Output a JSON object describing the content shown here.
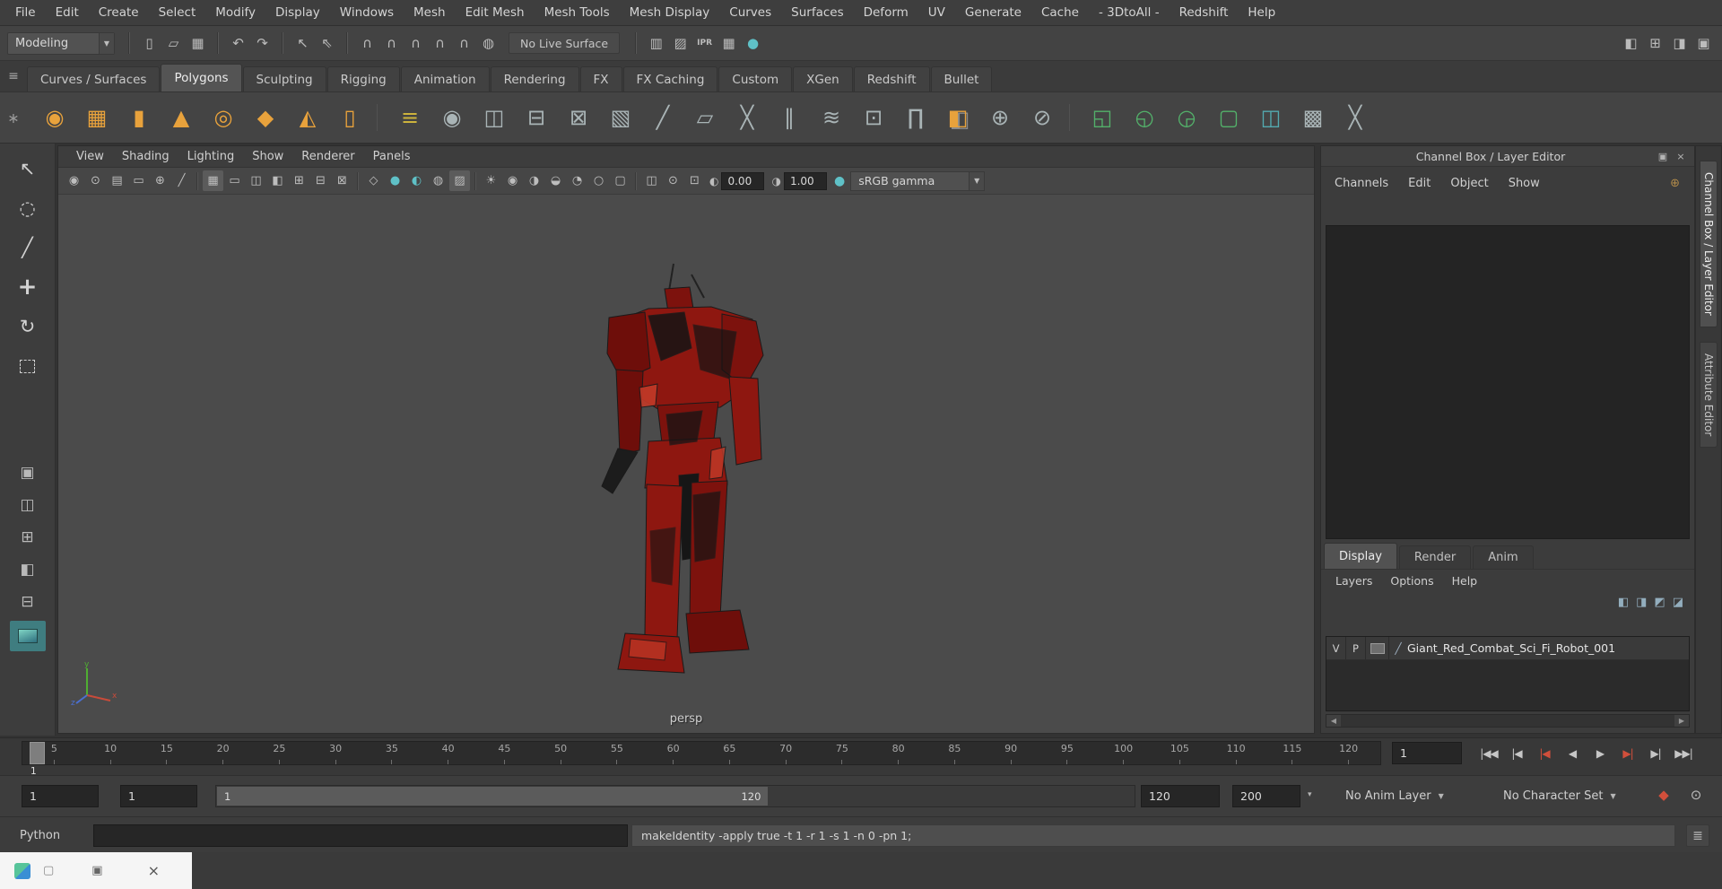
{
  "colors": {
    "shelf_orange": "#e8a23c",
    "shelf_green": "#53b06a",
    "viewport_teal": "#5fc1c7",
    "autokey_red": "#d14f3b",
    "robot_red": "#8e1710",
    "selection_blue": "#5285a6"
  },
  "menu_bar": {
    "items": [
      "File",
      "Edit",
      "Create",
      "Select",
      "Modify",
      "Display",
      "Windows",
      "Mesh",
      "Edit Mesh",
      "Mesh Tools",
      "Mesh Display",
      "Curves",
      "Surfaces",
      "Deform",
      "UV",
      "Generate",
      "Cache",
      "- 3DtoAll -",
      "Redshift",
      "Help"
    ]
  },
  "icons": {
    "chevron_down": "▼",
    "chevron_small": "▾",
    "shelf_menu": "≡",
    "shelf_gear": "∗",
    "scroll_left": "◀",
    "scroll_right": "▶",
    "script_editor": "≣",
    "exposure": "◐",
    "gamma": "◑",
    "color_management": "●",
    "layer_type": "╱",
    "manipulator": "⊕"
  },
  "toolbar": {
    "mode_selector": "Modeling",
    "live_surface": "No Live Surface",
    "file_icons": [
      {
        "name": "new-scene-icon",
        "glyph": "▯"
      },
      {
        "name": "open-scene-icon",
        "glyph": "▱"
      },
      {
        "name": "save-scene-icon",
        "glyph": "▦"
      }
    ],
    "undo_icons": [
      {
        "name": "undo-icon",
        "glyph": "↶"
      },
      {
        "name": "redo-icon",
        "glyph": "↷"
      }
    ],
    "selection_icons": [
      {
        "name": "select-by-hierarchy-icon",
        "glyph": "↖"
      },
      {
        "name": "select-by-object-icon",
        "glyph": "⇖"
      }
    ],
    "snap_icons": [
      {
        "name": "snap-to-grid-icon",
        "glyph": "∩"
      },
      {
        "name": "snap-to-curve-icon",
        "glyph": "∩"
      },
      {
        "name": "snap-to-point-icon",
        "glyph": "∩"
      },
      {
        "name": "snap-to-projected-center-icon",
        "glyph": "∩"
      },
      {
        "name": "snap-to-view-plane-icon",
        "glyph": "∩"
      },
      {
        "name": "make-live-icon",
        "glyph": "◍"
      }
    ],
    "render_icons": [
      {
        "name": "render-view-icon",
        "glyph": "▥"
      },
      {
        "name": "render-current-frame-icon",
        "glyph": "▨"
      },
      {
        "name": "ipr-render-icon",
        "glyph": "IPR",
        "cls": "ipr"
      },
      {
        "name": "render-settings-icon",
        "glyph": "▦"
      },
      {
        "name": "hypershade-icon",
        "glyph": "●",
        "cls": "teal"
      }
    ],
    "workspace_icons": [
      {
        "name": "workspace-outliner-icon",
        "glyph": "◧"
      },
      {
        "name": "workspace-four-view-icon",
        "glyph": "⊞"
      },
      {
        "name": "workspace-side-by-side-icon",
        "glyph": "◨"
      },
      {
        "name": "workspace-full-icon",
        "glyph": "▣"
      }
    ]
  },
  "shelf": {
    "tabs": [
      {
        "label": "Curves / Surfaces"
      },
      {
        "label": "Polygons",
        "active": true
      },
      {
        "label": "Sculpting"
      },
      {
        "label": "Rigging"
      },
      {
        "label": "Animation"
      },
      {
        "label": "Rendering"
      },
      {
        "label": "FX"
      },
      {
        "label": "FX Caching"
      },
      {
        "label": "Custom"
      },
      {
        "label": "XGen"
      },
      {
        "label": "Redshift"
      },
      {
        "label": "Bullet"
      }
    ],
    "primitive_icons": [
      {
        "name": "poly-sphere-icon",
        "glyph": "◉",
        "cls": "orange"
      },
      {
        "name": "poly-cube-icon",
        "glyph": "▦",
        "cls": "orange"
      },
      {
        "name": "poly-cylinder-icon",
        "glyph": "▮",
        "cls": "orange"
      },
      {
        "name": "poly-cone-icon",
        "glyph": "▲",
        "cls": "orange"
      },
      {
        "name": "poly-torus-icon",
        "glyph": "◎",
        "cls": "orange"
      },
      {
        "name": "poly-plane-icon",
        "glyph": "◆",
        "cls": "orange"
      },
      {
        "name": "poly-pyramid-icon",
        "glyph": "◭",
        "cls": "orange"
      },
      {
        "name": "poly-pipe-icon",
        "glyph": "▯",
        "cls": "orange"
      }
    ],
    "edit_icons": [
      {
        "name": "sweep-mesh-icon",
        "glyph": "≡",
        "cls": "olive"
      },
      {
        "name": "smooth-mesh-icon",
        "glyph": "◉"
      },
      {
        "name": "combine-icon",
        "glyph": "◫"
      },
      {
        "name": "separate-icon",
        "glyph": "⊟"
      },
      {
        "name": "extract-icon",
        "glyph": "⊠"
      },
      {
        "name": "fill-hole-icon",
        "glyph": "▧"
      },
      {
        "name": "create-polygon-icon",
        "glyph": "╱"
      },
      {
        "name": "quad-draw-icon",
        "glyph": "▱"
      },
      {
        "name": "multi-cut-icon",
        "glyph": "╳"
      },
      {
        "name": "insert-edge-loop-icon",
        "glyph": "∥"
      },
      {
        "name": "offset-edge-loop-icon",
        "glyph": "≋"
      },
      {
        "name": "target-weld-icon",
        "glyph": "⊡"
      },
      {
        "name": "bridge-icon",
        "glyph": "∏"
      },
      {
        "name": "mirror-icon",
        "glyph": "◧",
        "cls": "mix"
      },
      {
        "name": "center-pivot-icon",
        "glyph": "⊕"
      },
      {
        "name": "freeze-transformations-icon",
        "glyph": "⊘"
      }
    ],
    "boolean_icons": [
      {
        "name": "boolean-union-icon",
        "glyph": "◱",
        "cls": "green"
      },
      {
        "name": "boolean-difference-icon",
        "glyph": "◵",
        "cls": "green"
      },
      {
        "name": "boolean-intersection-icon",
        "glyph": "◶",
        "cls": "green"
      },
      {
        "name": "boolean-slice-icon",
        "glyph": "▢",
        "cls": "green"
      },
      {
        "name": "duplicate-along-path-icon",
        "glyph": "◫",
        "cls": "teal"
      },
      {
        "name": "uv-checker-icon",
        "glyph": "▩"
      },
      {
        "name": "transfer-attributes-icon",
        "glyph": "╳"
      }
    ]
  },
  "toolbox": {
    "tools": [
      {
        "name": "select-tool",
        "glyph": "↖"
      },
      {
        "name": "lasso-tool",
        "glyph": "◌"
      },
      {
        "name": "paint-select-tool",
        "glyph": "╱"
      },
      {
        "name": "move-tool",
        "glyph": "+",
        "cls": "big"
      },
      {
        "name": "rotate-tool",
        "glyph": "↻"
      },
      {
        "name": "scale-tool",
        "glyph": "",
        "cls": "dashed"
      }
    ],
    "layouts": [
      {
        "name": "single-pane-layout-icon",
        "glyph": "▣"
      },
      {
        "name": "two-pane-layout-icon",
        "glyph": "◫"
      },
      {
        "name": "four-pane-layout-icon",
        "glyph": "⊞"
      },
      {
        "name": "outliner-layout-icon",
        "glyph": "◧"
      },
      {
        "name": "graph-editor-layout-icon",
        "glyph": "⊟"
      },
      {
        "name": "persp-camera-thumbnail-icon",
        "glyph": "▰",
        "cls": "teal-bg"
      }
    ]
  },
  "viewport": {
    "menus": [
      "View",
      "Shading",
      "Lighting",
      "Show",
      "Renderer",
      "Panels"
    ],
    "camera_icons": [
      {
        "name": "camera-icon",
        "glyph": "◉"
      },
      {
        "name": "camera-attributes-icon",
        "glyph": "⊙"
      },
      {
        "name": "bookmark-icon",
        "glyph": "▤"
      },
      {
        "name": "image-plane-icon",
        "glyph": "▭"
      },
      {
        "name": "two-d-pan-zoom-icon",
        "glyph": "⊕"
      },
      {
        "name": "grease-pencil-icon",
        "glyph": "╱"
      }
    ],
    "gate_icons": [
      {
        "name": "grid-toggle-icon",
        "glyph": "▦",
        "cls": "active"
      },
      {
        "name": "film-gate-icon",
        "glyph": "▭"
      },
      {
        "name": "resolution-gate-icon",
        "glyph": "◫"
      },
      {
        "name": "gate-mask-icon",
        "glyph": "◧"
      },
      {
        "name": "field-chart-icon",
        "glyph": "⊞"
      },
      {
        "name": "safe-action-icon",
        "glyph": "⊟"
      },
      {
        "name": "safe-title-icon",
        "glyph": "⊠"
      }
    ],
    "shade_icons": [
      {
        "name": "wireframe-icon",
        "glyph": "◇"
      },
      {
        "name": "smooth-shade-icon",
        "glyph": "●",
        "cls": "teal"
      },
      {
        "name": "textured-icon",
        "glyph": "◐",
        "cls": "teal"
      },
      {
        "name": "wireframe-on-shaded-icon",
        "glyph": "◍"
      },
      {
        "name": "use-default-material-icon",
        "glyph": "▨",
        "cls": "active"
      }
    ],
    "light_icons": [
      {
        "name": "default-lighting-icon",
        "glyph": "☀"
      },
      {
        "name": "all-lights-icon",
        "glyph": "◉"
      },
      {
        "name": "shadows-icon",
        "glyph": "◑"
      },
      {
        "name": "occlusion-icon",
        "glyph": "◒"
      },
      {
        "name": "motion-blur-icon",
        "glyph": "◔"
      },
      {
        "name": "multisample-icon",
        "glyph": "○"
      },
      {
        "name": "isolate-select-icon",
        "glyph": "▢"
      }
    ],
    "xray_icons": [
      {
        "name": "xray-icon",
        "glyph": "◫"
      },
      {
        "name": "xray-joints-icon",
        "glyph": "⊙"
      },
      {
        "name": "exposure-contrast-icon",
        "glyph": "⊡"
      }
    ],
    "exposure": "0.00",
    "gamma": "1.00",
    "view_transform": "sRGB gamma",
    "camera_label": "persp",
    "axis": {
      "x": "x",
      "y": "y",
      "z": "z"
    }
  },
  "channel_box": {
    "title": "Channel Box / Layer Editor",
    "header_icons": [
      {
        "name": "dock-icon",
        "glyph": "▣"
      },
      {
        "name": "close-icon",
        "glyph": "×"
      }
    ],
    "menus": [
      "Channels",
      "Edit",
      "Object",
      "Show"
    ],
    "layer_tabs": [
      {
        "label": "Display",
        "active": true
      },
      {
        "label": "Render"
      },
      {
        "label": "Anim"
      }
    ],
    "layer_menus": [
      "Layers",
      "Options",
      "Help"
    ],
    "layer_toolbar_icons": [
      {
        "name": "layer-new-empty-icon",
        "glyph": "◧"
      },
      {
        "name": "layer-new-from-selected-icon",
        "glyph": "◨"
      },
      {
        "name": "layer-move-up-icon",
        "glyph": "◩"
      },
      {
        "name": "layer-sync-icon",
        "glyph": "◪"
      }
    ],
    "layer": {
      "visibility": "V",
      "playback": "P",
      "name": "Giant_Red_Combat_Sci_Fi_Robot_001"
    }
  },
  "side_tabs": [
    {
      "label": "Channel Box / Layer Editor",
      "active": true
    },
    {
      "label": "Attribute Editor"
    }
  ],
  "timeline": {
    "ticks": [
      5,
      10,
      15,
      20,
      25,
      30,
      35,
      40,
      45,
      50,
      55,
      60,
      65,
      70,
      75,
      80,
      85,
      90,
      95,
      100,
      105,
      110,
      115,
      120
    ],
    "current_frame": "1",
    "frame_field": "1",
    "playback_buttons": [
      {
        "name": "go-to-start-button",
        "glyph": "|◀◀"
      },
      {
        "name": "step-back-frame-button",
        "glyph": "|◀"
      },
      {
        "name": "step-back-key-button",
        "glyph": "|◀",
        "cls": "red"
      },
      {
        "name": "play-backwards-button",
        "glyph": "◀"
      },
      {
        "name": "play-forwards-button",
        "glyph": "▶"
      },
      {
        "name": "step-forward-key-button",
        "glyph": "▶|",
        "cls": "red"
      },
      {
        "name": "step-forward-frame-button",
        "glyph": "▶|"
      },
      {
        "name": "go-to-end-button",
        "glyph": "▶▶|"
      }
    ]
  },
  "range_slider": {
    "animation_start": "1",
    "playback_start": "1",
    "inner_start": "1",
    "inner_end": "120",
    "playback_end": "120",
    "animation_end": "200",
    "anim_layer": "No Anim Layer",
    "character_set": "No Character Set",
    "icons": [
      {
        "name": "auto-key-icon",
        "glyph": "◆",
        "cls": "red"
      },
      {
        "name": "animation-preferences-icon",
        "glyph": "⊙"
      }
    ]
  },
  "command_line": {
    "label": "Python",
    "history": "makeIdentity -apply true -t 1 -r 1 -s 1 -n 0 -pn 1;"
  },
  "bottom_bar": {
    "box_glyph": "▢",
    "restore_glyph": "▣",
    "close_glyph": "×"
  }
}
